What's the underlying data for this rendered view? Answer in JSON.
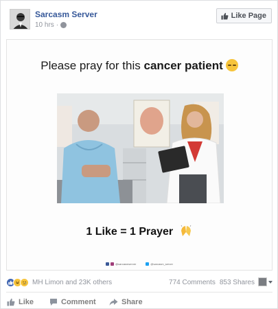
{
  "header": {
    "page_name": "Sarcasm Server",
    "timestamp": "10 hrs",
    "privacy_icon": "globe-icon",
    "like_page_label": "Like Page"
  },
  "post_image": {
    "headline_normal": "Please pray for this ",
    "headline_bold": "cancer patient",
    "caption": "1 Like = 1 Prayer",
    "social_instagram": "@sarcasmserver",
    "social_twitter": "@sarcasm_server"
  },
  "stats": {
    "reactions": [
      "like-icon",
      "haha-icon",
      "sad-icon"
    ],
    "reactors_text": "MH Limon and 23K others",
    "comments_text": "774 Comments",
    "shares_text": "853 Shares"
  },
  "actions": {
    "like_label": "Like",
    "comment_label": "Comment",
    "share_label": "Share"
  },
  "colors": {
    "link_blue": "#365899",
    "muted_gray": "#90949c",
    "like_blue": "#4267b2",
    "emoji_yellow": "#f7c43b"
  }
}
